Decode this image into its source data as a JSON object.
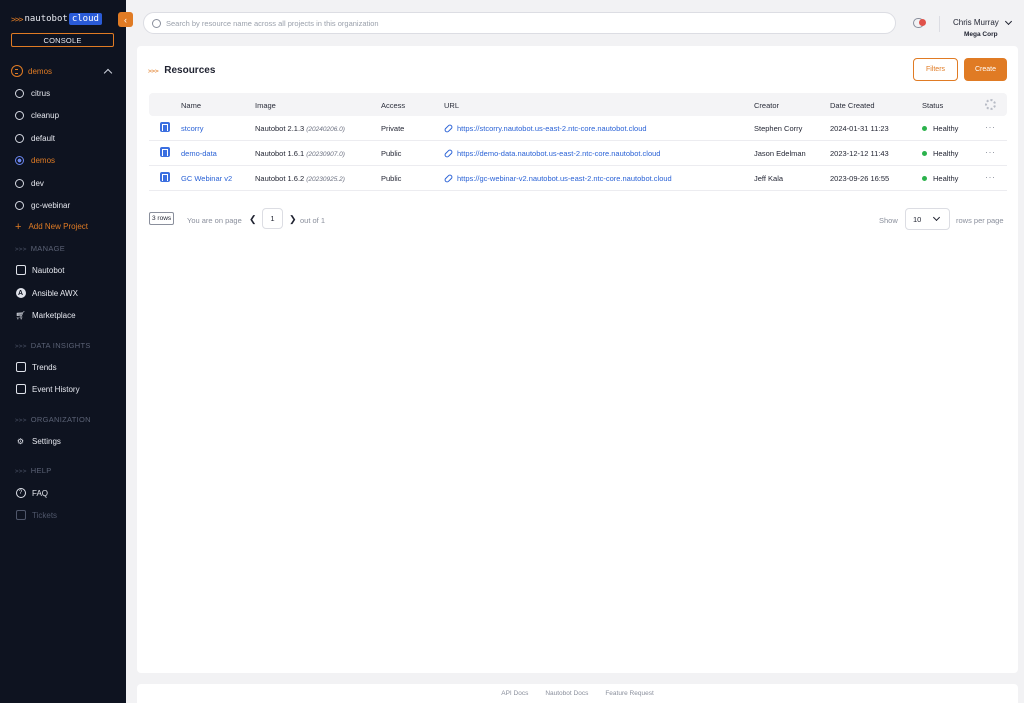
{
  "brand": {
    "chevrons": ">>>",
    "name": "nautobot",
    "cloud": "cloud",
    "collapse_glyph": "‹"
  },
  "sidebar": {
    "console_label": "CONSOLE",
    "current_project": "demos",
    "projects": [
      {
        "label": "citrus",
        "active": false
      },
      {
        "label": "cleanup",
        "active": false
      },
      {
        "label": "default",
        "active": false
      },
      {
        "label": "demos",
        "active": true
      },
      {
        "label": "dev",
        "active": false
      },
      {
        "label": "gc-webinar",
        "active": false
      }
    ],
    "add_project_label": "Add New Project",
    "sections": {
      "manage": "MANAGE",
      "data_insights": "DATA INSIGHTS",
      "organization": "ORGANIZATION",
      "help": "HELP"
    },
    "section_chevrons": ">>>",
    "items": {
      "nautobot": "Nautobot",
      "ansible": "Ansible AWX",
      "marketplace": "Marketplace",
      "trends": "Trends",
      "event_history": "Event History",
      "settings": "Settings",
      "faq": "FAQ",
      "tickets": "Tickets"
    }
  },
  "topbar": {
    "search_placeholder": "Search by resource name across all projects in this organization",
    "user_name": "Chris Murray",
    "org_name": "Mega Corp"
  },
  "resources": {
    "title": "Resources",
    "filters_label": "Filters",
    "create_label": "Create",
    "columns": [
      "Name",
      "Image",
      "Access",
      "URL",
      "Creator",
      "Date Created",
      "Status"
    ],
    "rows": [
      {
        "name": "stcorry",
        "image": "Nautobot 2.1.3",
        "image_ver": "(20240206.0)",
        "access": "Private",
        "url": "https://stcorry.nautobot.us-east-2.ntc-core.nautobot.cloud",
        "creator": "Stephen Corry",
        "date": "2024-01-31 11:23",
        "status": "Healthy"
      },
      {
        "name": "demo-data",
        "image": "Nautobot 1.6.1",
        "image_ver": "(20230907.0)",
        "access": "Public",
        "url": "https://demo-data.nautobot.us-east-2.ntc-core.nautobot.cloud",
        "creator": "Jason Edelman",
        "date": "2023-12-12 11:43",
        "status": "Healthy"
      },
      {
        "name": "GC Webinar v2",
        "image": "Nautobot 1.6.2",
        "image_ver": "(20230925.2)",
        "access": "Public",
        "url": "https://gc-webinar-v2.nautobot.us-east-2.ntc-core.nautobot.cloud",
        "creator": "Jeff Kala",
        "date": "2023-09-26 16:55",
        "status": "Healthy"
      }
    ],
    "more_glyph": "···"
  },
  "pager": {
    "rows_badge": "3 rows",
    "on_page_text": "You are on page",
    "prev_glyph": "❮",
    "page": "1",
    "next_glyph": "❯",
    "out_of_text": "out of 1",
    "show_label": "Show",
    "per_page": "10",
    "per_page_suffix": "rows per page"
  },
  "footer": {
    "links": [
      "API Docs",
      "Nautobot Docs",
      "Feature Request"
    ]
  },
  "colors": {
    "accent": "#e07b24",
    "sidebar_bg": "#0e1320",
    "link": "#2a62d6",
    "healthy": "#2bb24c"
  }
}
